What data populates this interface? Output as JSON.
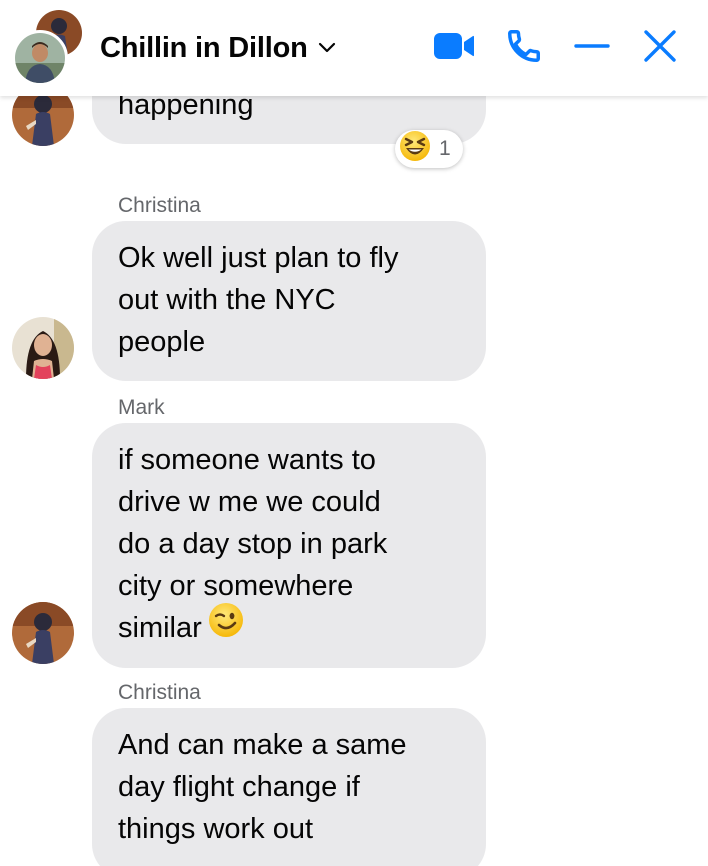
{
  "header": {
    "title": "Chillin in Dillon",
    "icons": [
      "video-camera-icon",
      "phone-icon",
      "minimize-icon",
      "close-icon"
    ],
    "accent_color": "#0a7cff"
  },
  "messages": [
    {
      "sender": "",
      "text": "happening",
      "reaction": {
        "emoji": "laughing-emoji",
        "count": "1"
      }
    },
    {
      "sender": "Christina",
      "lines": [
        "Ok well just plan to fly",
        "out with the NYC",
        "people"
      ]
    },
    {
      "sender": "Mark",
      "lines": [
        "if someone wants to",
        "drive w me we could",
        "do a day stop in park",
        "city or somewhere",
        "similar"
      ],
      "trailing_emoji": "winking-emoji"
    },
    {
      "sender": "Christina",
      "lines": [
        "And can make a same",
        "day flight change if",
        "things work out"
      ]
    }
  ],
  "colors": {
    "bubble_background": "#e9e9eb",
    "sender_name": "#65676b",
    "text": "#050505"
  }
}
